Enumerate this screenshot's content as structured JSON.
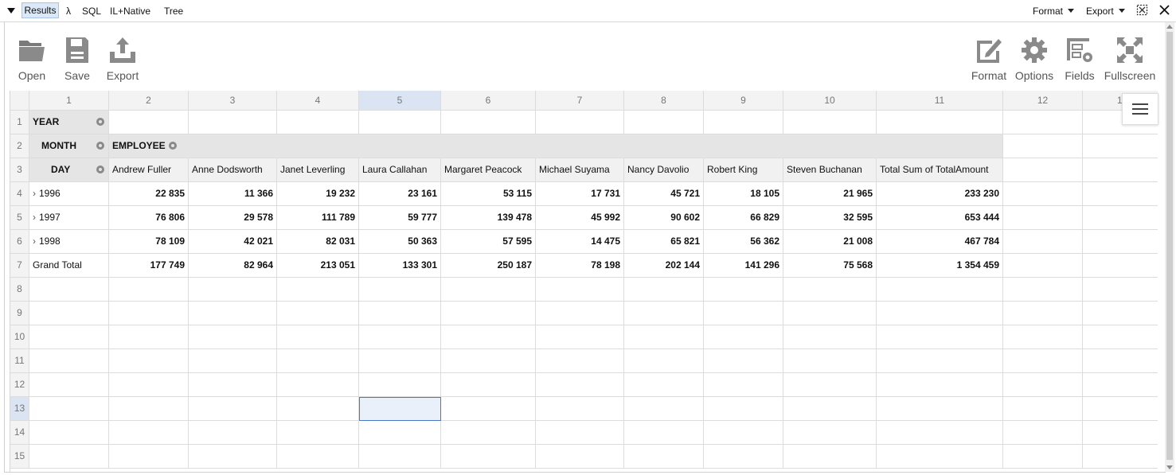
{
  "topbar": {
    "tabs": [
      "Results",
      "λ",
      "SQL",
      "IL+Native",
      "Tree"
    ],
    "format_label": "Format",
    "export_label": "Export"
  },
  "toolbar": {
    "left": [
      {
        "label": "Open",
        "icon": "folder-icon"
      },
      {
        "label": "Save",
        "icon": "save-icon"
      },
      {
        "label": "Export",
        "icon": "export-icon"
      }
    ],
    "right": [
      {
        "label": "Format",
        "icon": "format-icon"
      },
      {
        "label": "Options",
        "icon": "gear-icon"
      },
      {
        "label": "Fields",
        "icon": "fields-icon"
      },
      {
        "label": "Fullscreen",
        "icon": "fullscreen-icon"
      }
    ]
  },
  "grid": {
    "column_headers": [
      "1",
      "2",
      "3",
      "4",
      "5",
      "6",
      "7",
      "8",
      "9",
      "10",
      "11",
      "12",
      "13"
    ],
    "row_headers": [
      "1",
      "2",
      "3",
      "4",
      "5",
      "6",
      "7",
      "8",
      "9",
      "10",
      "11",
      "12",
      "13",
      "14",
      "15"
    ],
    "selected_column": "5",
    "selected_row": "13",
    "row_field": "YEAR",
    "month_field": "MONTH",
    "day_field": "DAY",
    "column_field": "EMPLOYEE",
    "employees": [
      "Andrew Fuller",
      "Anne Dodsworth",
      "Janet Leverling",
      "Laura Callahan",
      "Margaret Peacock",
      "Michael Suyama",
      "Nancy Davolio",
      "Robert King",
      "Steven Buchanan",
      "Total Sum of TotalAmount"
    ],
    "rows": [
      {
        "label": "1996",
        "values": [
          "22 835",
          "11 366",
          "19 232",
          "23 161",
          "53 115",
          "17 731",
          "45 721",
          "18 105",
          "21 965",
          "233 230"
        ]
      },
      {
        "label": "1997",
        "values": [
          "76 806",
          "29 578",
          "111 789",
          "59 777",
          "139 478",
          "45 992",
          "90 602",
          "66 829",
          "32 595",
          "653 444"
        ]
      },
      {
        "label": "1998",
        "values": [
          "78 109",
          "42 021",
          "82 031",
          "50 363",
          "57 595",
          "14 475",
          "65 821",
          "56 362",
          "21 008",
          "467 784"
        ]
      },
      {
        "label": "Grand Total",
        "values": [
          "177 749",
          "82 964",
          "213 051",
          "133 301",
          "250 187",
          "78 198",
          "202 144",
          "141 296",
          "75 568",
          "1 354 459"
        ]
      }
    ]
  }
}
